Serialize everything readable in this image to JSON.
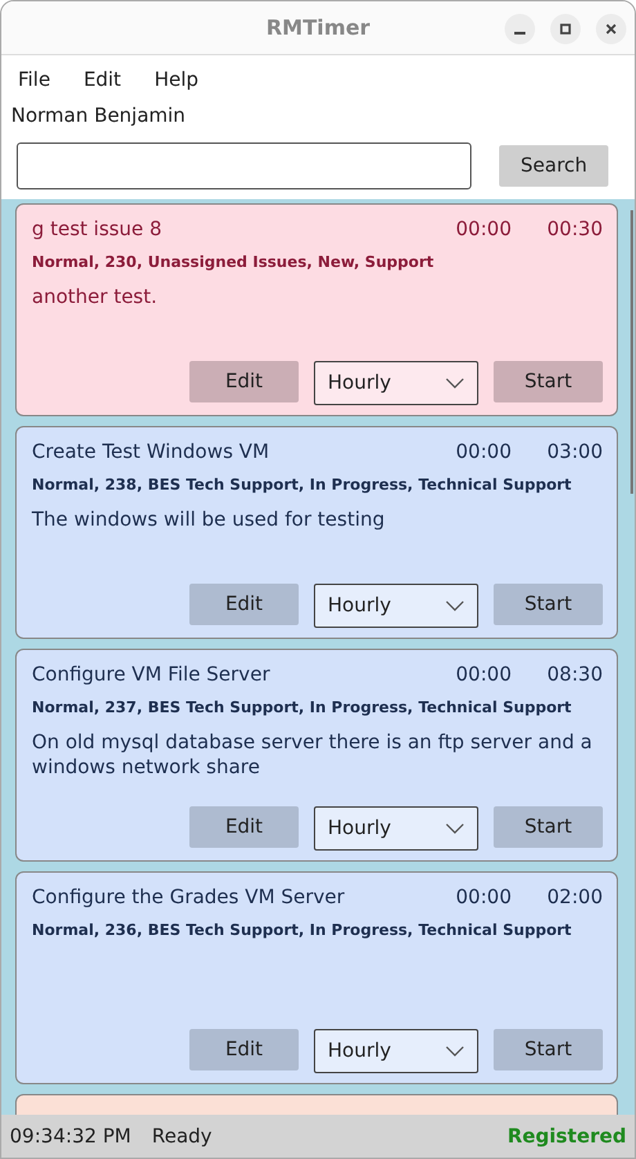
{
  "window": {
    "title": "RMTimer"
  },
  "menu": [
    "File",
    "Edit",
    "Help"
  ],
  "user": "Norman Benjamin",
  "search": {
    "button": "Search"
  },
  "cards": [
    {
      "kind": "alert",
      "color": "#fddce3",
      "title": "g test issue 8",
      "elapsed": "00:00",
      "estimate": "00:30",
      "tags": "Normal, 230, Unassigned Issues, New, Support",
      "description": "another test.",
      "edit": "Edit",
      "rate": "Hourly",
      "start": "Start"
    },
    {
      "kind": "normal",
      "color": "#d3e1fa",
      "title": "Create Test Windows VM",
      "elapsed": "00:00",
      "estimate": "03:00",
      "tags": "Normal, 238, BES Tech Support, In Progress, Technical Support",
      "description": "The windows will be used for testing",
      "edit": "Edit",
      "rate": "Hourly",
      "start": "Start"
    },
    {
      "kind": "normal",
      "color": "#d3e1fa",
      "title": "Configure VM File Server",
      "elapsed": "00:00",
      "estimate": "08:30",
      "tags": "Normal, 237, BES Tech Support, In Progress, Technical Support",
      "description": "On old mysql database server there is an ftp server and a windows network share",
      "edit": "Edit",
      "rate": "Hourly",
      "start": "Start"
    },
    {
      "kind": "normal",
      "color": "#d3e1fa",
      "title": "Configure the Grades VM Server",
      "elapsed": "00:00",
      "estimate": "02:00",
      "tags": "Normal, 236, BES Tech Support, In Progress, Technical Support",
      "edit": "Edit",
      "rate": "Hourly",
      "start": "Start"
    },
    {
      "kind": "normal",
      "color": "#fbe0d6"
    }
  ],
  "status_bar": {
    "time": "09:34:32 PM",
    "message": "Ready",
    "registration": "Registered"
  }
}
